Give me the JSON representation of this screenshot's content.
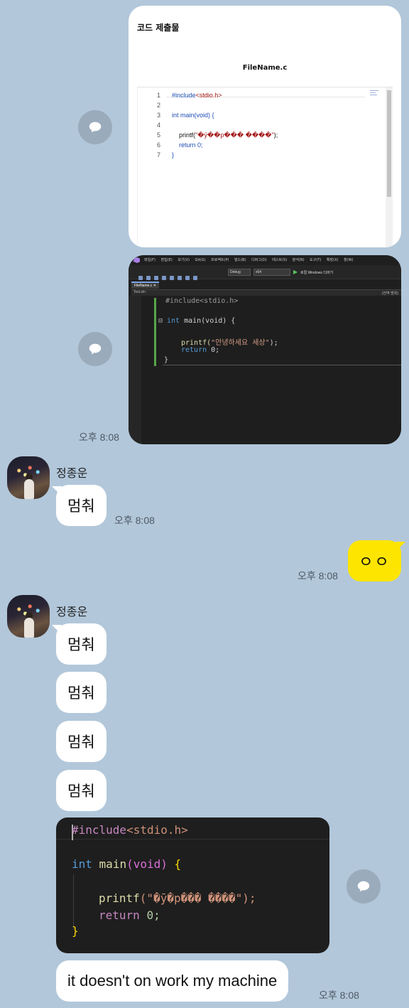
{
  "card1": {
    "title": "코드 제출물",
    "filename": "FileName.c",
    "lines": [
      {
        "n": "1",
        "parts": [
          {
            "t": "#include",
            "c": "kw1"
          },
          {
            "t": "<stdio.h>",
            "c": "hdr1"
          }
        ]
      },
      {
        "n": "2",
        "parts": []
      },
      {
        "n": "3",
        "parts": [
          {
            "t": "int main(void) {",
            "c": "kw1"
          }
        ]
      },
      {
        "n": "4",
        "parts": []
      },
      {
        "n": "5",
        "parts": [
          {
            "t": "    printf(",
            "c": ""
          },
          {
            "t": "\"�ȳ��p��� ����\"",
            "c": "str1"
          },
          {
            "t": ");",
            "c": ""
          }
        ]
      },
      {
        "n": "6",
        "parts": [
          {
            "t": "    return 0;",
            "c": "kw1"
          }
        ]
      },
      {
        "n": "7",
        "parts": [
          {
            "t": "}",
            "c": "kw1"
          }
        ]
      }
    ]
  },
  "card2": {
    "menu": "파일(F) 편집(E) 보기(V) Git(G) 프로젝트(P) 빌드(B) 디버그(D) 테스트(S) 분석(N) 도구(T) 확장(X) 창(W)",
    "config": "Debug",
    "platform": "x64",
    "run_label": "로컬 Windows 디버거",
    "tab": "FileName.c",
    "tab_close": "✕",
    "nav_left": "Test.sln",
    "nav_right": "(전역 범위)",
    "code": {
      "l1": "#include<stdio.h>",
      "l2_kw": "int",
      "l2_rest": " main(void) {",
      "l3_fn": "printf(",
      "l3_str": "\"안녕하세요 세상\"",
      "l3_end": ");",
      "l4_kw": "return",
      "l4_rest": " 0;",
      "l5": "}"
    }
  },
  "times": {
    "t1": "오후 8:08",
    "t2": "오후 8:08",
    "t3": "오후 8:08",
    "t4": "오후 8:08"
  },
  "sender": {
    "name1": "정종운",
    "name2": "정종운"
  },
  "messages": {
    "m1": "멈춰",
    "mine": "ㅇㅇ",
    "m2": "멈춰",
    "m3": "멈춰",
    "m4": "멈춰",
    "m5": "멈춰",
    "last": "it doesn't on work my machine"
  },
  "card3": {
    "inc": "#include",
    "hdr": "<stdio.h>",
    "kw_int": "int",
    "fn_main": "main",
    "paren_void": "(void)",
    "brace_open": "{",
    "fn_printf": "printf",
    "str": "(\"�ȳ�p��� ����\");",
    "ret": "return",
    "num": "0;",
    "brace_close": "}"
  },
  "icons": {
    "share": "share-bubble-icon"
  }
}
